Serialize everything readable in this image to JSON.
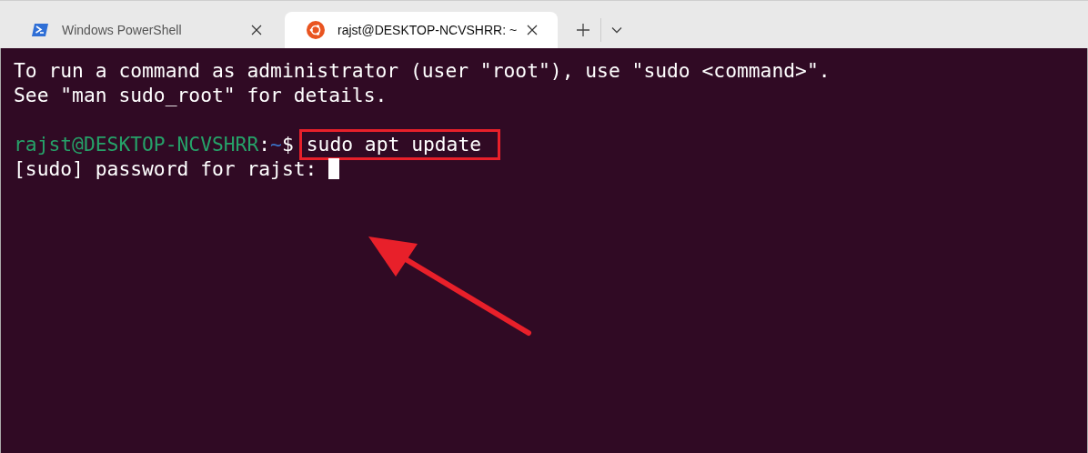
{
  "tabs": [
    {
      "label": "Windows PowerShell",
      "kind": "powershell",
      "selected": false
    },
    {
      "label": "rajst@DESKTOP-NCVSHRR: ~",
      "kind": "ubuntu",
      "selected": true
    }
  ],
  "terminal": {
    "lines": [
      {
        "kind": "output",
        "text": "To run a command as administrator (user \"root\"), use \"sudo <command>\"."
      },
      {
        "kind": "output",
        "text": "See \"man sudo_root\" for details."
      },
      {
        "kind": "blank"
      },
      {
        "kind": "prompt",
        "user_host": "rajst@DESKTOP-NCVSHRR",
        "colon": ":",
        "path": "~",
        "sigil": "$",
        "command": "sudo apt update",
        "highlighted": true
      },
      {
        "kind": "output",
        "text": "[sudo] password for rajst: ",
        "cursor": true
      }
    ]
  }
}
